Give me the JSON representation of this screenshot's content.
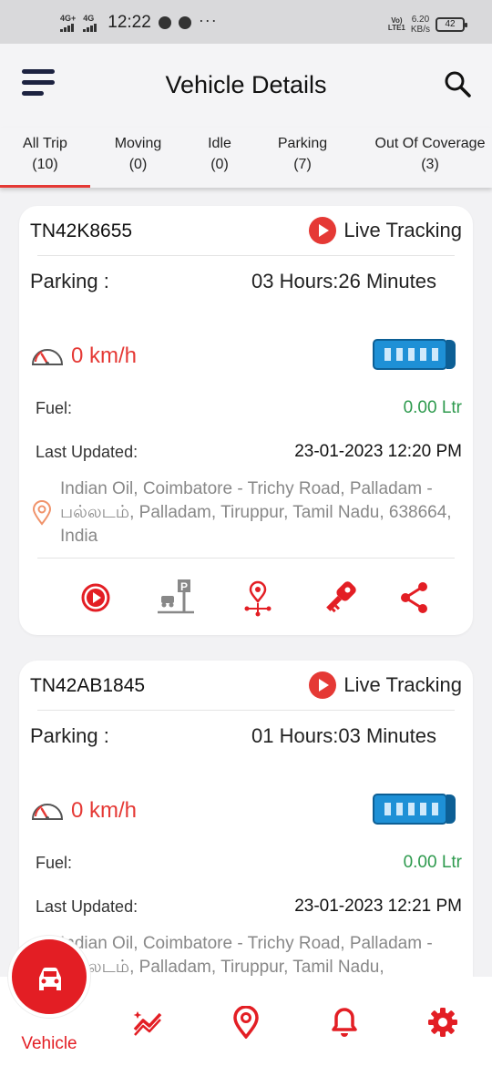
{
  "status_bar": {
    "sim1_label": "4G+",
    "sim2_label": "4G",
    "time": "12:22",
    "more": "···",
    "volte_line1": "Vo)",
    "volte_line2": "LTE1",
    "speed_value": "6.20",
    "speed_unit": "KB/s",
    "battery": "42"
  },
  "header": {
    "title": "Vehicle Details",
    "menu_icon": "hamburger-icon",
    "search_icon": "search-icon"
  },
  "tabs": [
    {
      "label": "All Trip",
      "count": "(10)",
      "active": true
    },
    {
      "label": "Moving",
      "count": "(0)"
    },
    {
      "label": "Idle",
      "count": "(0)"
    },
    {
      "label": "Parking",
      "count": "(7)"
    },
    {
      "label": "Out Of Coverage",
      "count": "(3)"
    }
  ],
  "vehicles": [
    {
      "number": "TN42K8655",
      "live_label": "Live Tracking",
      "status_label": "Parking :",
      "duration": "03 Hours:26 Minutes",
      "speed": "0 km/h",
      "fuel_label": "Fuel:",
      "fuel": "0.00 Ltr",
      "updated_label": "Last Updated:",
      "updated": "23-01-2023 12:20 PM",
      "address": "Indian Oil, Coimbatore - Trichy Road, Palladam - பல்லடம், Palladam, Tiruppur, Tamil Nadu, 638664, India"
    },
    {
      "number": "TN42AB1845",
      "live_label": "Live Tracking",
      "status_label": "Parking :",
      "duration": "01 Hours:03 Minutes",
      "speed": "0 km/h",
      "fuel_label": "Fuel:",
      "fuel": "0.00 Ltr",
      "updated_label": "Last Updated:",
      "updated": "23-01-2023 12:21 PM",
      "address": "Indian Oil, Coimbatore - Trichy Road, Palladam - பல்லடம், Palladam, Tiruppur, Tamil Nadu,"
    }
  ],
  "card_actions": [
    "playback-icon",
    "parking-icon",
    "route-pin-icon",
    "key-icon",
    "share-icon"
  ],
  "bottom_nav": {
    "active_label": "Vehicle",
    "items": [
      "car-icon",
      "chart-icon",
      "location-icon",
      "bell-icon",
      "gear-icon"
    ]
  },
  "colors": {
    "accent": "#e53935",
    "fuel": "#2e9a4e",
    "bus": "#1e90d6"
  }
}
